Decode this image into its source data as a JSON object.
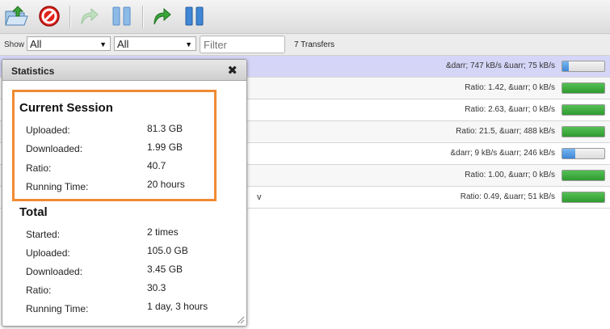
{
  "toolbar": {
    "buttons": [
      {
        "name": "open-torrent",
        "icon": "folder-open-icon"
      },
      {
        "name": "remove-torrent",
        "icon": "no-entry-icon"
      },
      {
        "name": "resume-selected",
        "icon": "curved-arrow-icon"
      },
      {
        "name": "pause-selected",
        "icon": "pause-icon"
      },
      {
        "name": "resume-all",
        "icon": "curved-arrow-icon"
      },
      {
        "name": "pause-all",
        "icon": "pause-icon"
      }
    ]
  },
  "filterbar": {
    "show_label": "Show",
    "state_filter": "All",
    "tracker_filter": "All",
    "filter_placeholder": "Filter",
    "transfers_count": "7 Transfers"
  },
  "transfers": [
    {
      "name": "",
      "stats": "&darr; 747 kB/s &uarr; 75 kB/s",
      "progress": 0.15,
      "color": "blue"
    },
    {
      "name": "",
      "stats": "Ratio: 1.42, &uarr; 0 kB/s",
      "progress": 1.0,
      "color": "green"
    },
    {
      "name": "",
      "stats": "Ratio: 2.63, &uarr; 0 kB/s",
      "progress": 1.0,
      "color": "green"
    },
    {
      "name": "",
      "stats": "Ratio: 21.5, &uarr; 488 kB/s",
      "progress": 1.0,
      "color": "green"
    },
    {
      "name": "",
      "stats": "&darr; 9 kB/s &uarr; 246 kB/s",
      "progress": 0.3,
      "color": "blue"
    },
    {
      "name": "",
      "stats": "Ratio: 1.00, &uarr; 0 kB/s",
      "progress": 1.0,
      "color": "green"
    },
    {
      "name": "v",
      "stats": "Ratio: 0.49, &uarr; 51 kB/s",
      "progress": 1.0,
      "color": "green"
    }
  ],
  "statistics_dialog": {
    "title": "Statistics",
    "close_glyph": "✖",
    "current_session": {
      "heading": "Current Session",
      "rows": [
        {
          "label": "Uploaded:",
          "value": "81.3 GB"
        },
        {
          "label": "Downloaded:",
          "value": "1.99 GB"
        },
        {
          "label": "Ratio:",
          "value": "40.7"
        },
        {
          "label": "Running Time:",
          "value": "20 hours"
        }
      ]
    },
    "total": {
      "heading": "Total",
      "rows": [
        {
          "label": "Started:",
          "value": "2 times"
        },
        {
          "label": "Uploaded:",
          "value": "105.0 GB"
        },
        {
          "label": "Downloaded:",
          "value": "3.45 GB"
        },
        {
          "label": "Ratio:",
          "value": "30.3"
        },
        {
          "label": "Running Time:",
          "value": "1 day, 3 hours"
        }
      ]
    }
  },
  "colors": {
    "highlight": "#f08a33",
    "selected_row": "#d5d5f7",
    "progress_green": "#2f9a2f",
    "progress_blue": "#3f86d6"
  }
}
